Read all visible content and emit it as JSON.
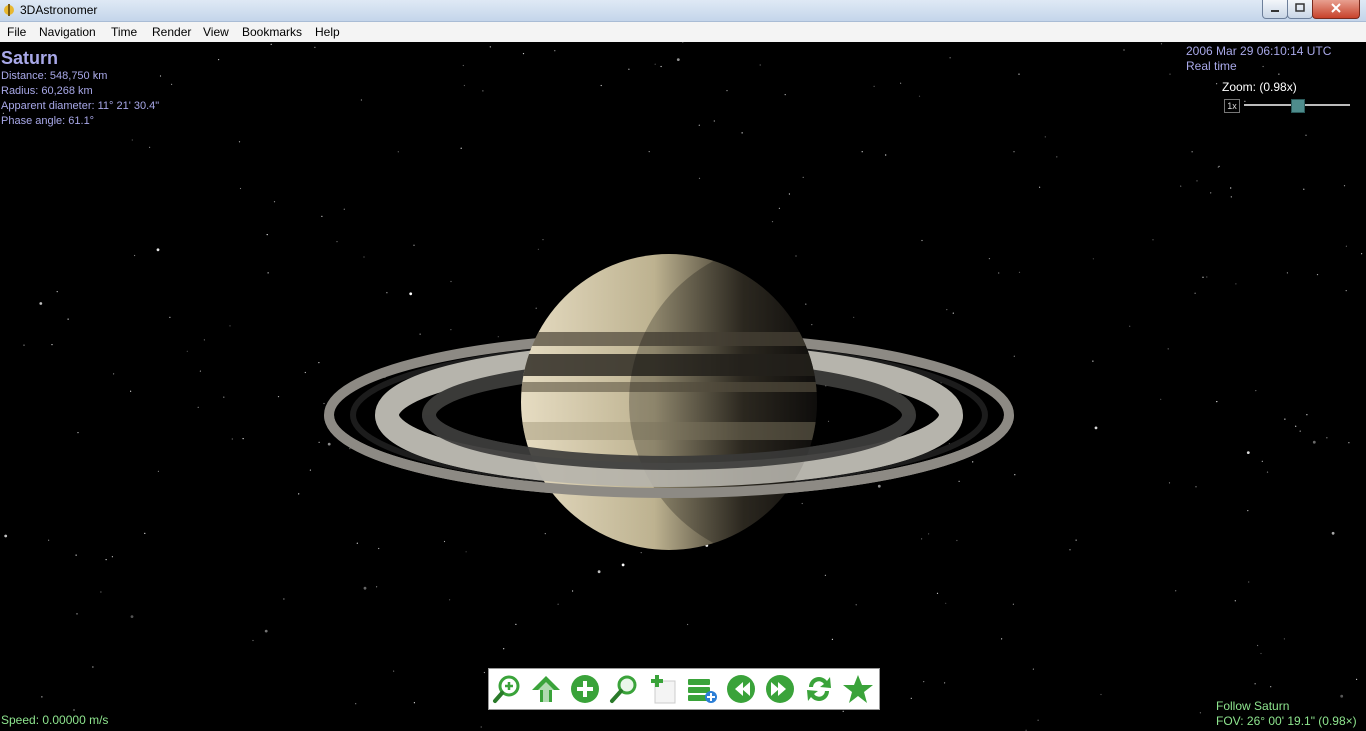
{
  "window": {
    "title": "3DAstronomer"
  },
  "menu": [
    "File",
    "Navigation",
    "Time",
    "Render",
    "View",
    "Bookmarks",
    "Help"
  ],
  "object": {
    "name": "Saturn",
    "distance": "Distance: 548,750 km",
    "radius": "Radius: 60,268 km",
    "apparent_diameter": "Apparent diameter: 11° 21' 30.4\"",
    "phase_angle": "Phase angle: 61.1°"
  },
  "time": {
    "datetime": "2006 Mar 29 06:10:14 UTC",
    "mode": "Real time"
  },
  "zoom": {
    "label": "Zoom: (0.98x)",
    "reset_label": "1x",
    "level": 0.5
  },
  "speed": "Speed: 0.00000 m/s",
  "follow": {
    "target": "Follow Saturn",
    "fov": "FOV: 26° 00' 19.1\" (0.98×)"
  },
  "toolbar": [
    "zoom-in-icon",
    "up-arrow-icon",
    "add-icon",
    "search-icon",
    "add-item-icon",
    "add-layer-icon",
    "rewind-icon",
    "fast-forward-icon",
    "refresh-icon",
    "star-icon"
  ],
  "colors": {
    "hud_text": "#a8a8e8",
    "status_text": "#8ee58e",
    "tool_green": "#3aa33a"
  }
}
